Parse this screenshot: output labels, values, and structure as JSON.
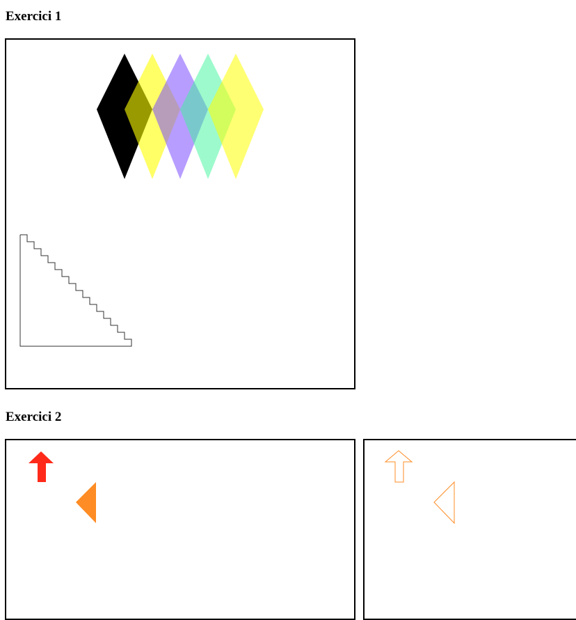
{
  "sections": {
    "exercise1": {
      "title": "Exercici 1"
    },
    "exercise2": {
      "title": "Exercici 2"
    }
  },
  "colors": {
    "diamond_black": "#000000",
    "diamond_yellow": "#ffff00",
    "diamond_purple": "#7b4dff",
    "diamond_mint": "#3cf59a",
    "staircase_stroke": "#333333",
    "arrow_red": "#ff2a1a",
    "triangle_orange": "#ff8c24"
  }
}
